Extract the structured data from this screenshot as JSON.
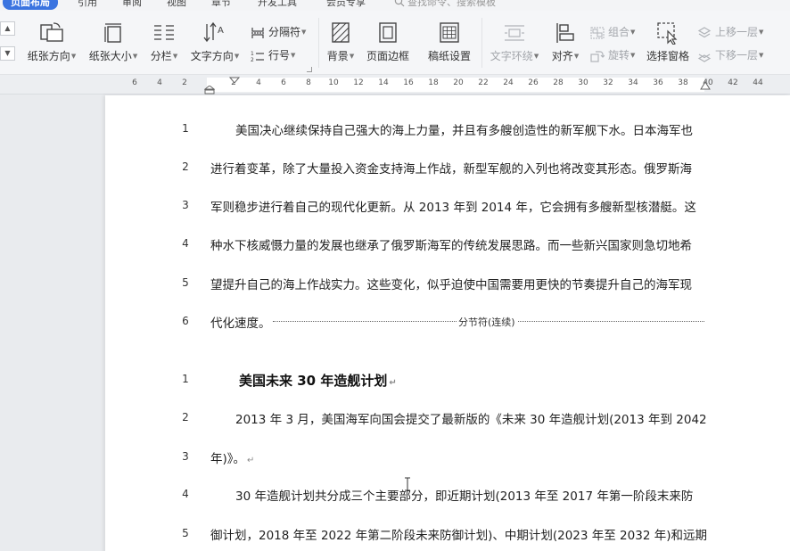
{
  "tabs": [
    "页面布局",
    "引用",
    "审阅",
    "视图",
    "章节",
    "开发工具",
    "会员专享"
  ],
  "active_tab": "页面布局",
  "search": {
    "placeholder": "查找命令、搜索模板"
  },
  "ribbon": {
    "paper_direction": "纸张方向",
    "paper_size": "纸张大小",
    "columns": "分栏",
    "text_direction": "文字方向",
    "separator": "分隔符",
    "line_number": "行号",
    "background": "背景",
    "page_border": "页面边框",
    "manuscript": "稿纸设置",
    "text_wrap": "文字环绕",
    "align": "对齐",
    "group": "组合",
    "rotate": "旋转",
    "selection_pane": "选择窗格",
    "bring_forward": "上移一层",
    "send_backward": "下移一层"
  },
  "ruler": {
    "ticks": [
      "6",
      "4",
      "2",
      "2",
      "4",
      "6",
      "8",
      "10",
      "12",
      "14",
      "16",
      "18",
      "20",
      "22",
      "24",
      "26",
      "28",
      "30",
      "32",
      "34",
      "36",
      "38",
      "40",
      "42",
      "44"
    ]
  },
  "document": {
    "section1": [
      {
        "num": "1",
        "text": "美国决心继续保持自己强大的海上力量，并且有多艘创造性的新军舰下水。日本海军也"
      },
      {
        "num": "2",
        "text": "进行着变革，除了大量投入资金支持海上作战，新型军舰的入列也将改变其形态。俄罗斯海"
      },
      {
        "num": "3",
        "text": "军则稳步进行着自己的现代化更新。从 2013 年到 2014 年，它会拥有多艘新型核潜艇。这"
      },
      {
        "num": "4",
        "text": "种水下核威慑力量的发展也继承了俄罗斯海军的传统发展思路。而一些新兴国家则急切地希"
      },
      {
        "num": "5",
        "text": "望提升自己的海上作战实力。这些变化，似乎迫使中国需要用更快的节奏提升自己的海军现"
      },
      {
        "num": "6",
        "text": "代化速度。"
      }
    ],
    "section_break": "分节符(连续)",
    "section2": [
      {
        "num": "1",
        "text": "美国未来 30 年造舰计划"
      },
      {
        "num": "2",
        "text": "2013 年 3 月，美国海军向国会提交了最新版的《未来 30 年造舰计划(2013 年到 2042"
      },
      {
        "num": "3",
        "text": "年)》。"
      },
      {
        "num": "4",
        "text": "30 年造舰计划共分成三个主要部分，即近期计划(2013 年至 2017 年第一阶段末来防"
      },
      {
        "num": "5",
        "text": "御计划，2018 年至 2022 年第二阶段未来防御计划)、中期计划(2023 年至 2032 年)和远期"
      }
    ],
    "paragraph_mark": "↵"
  }
}
